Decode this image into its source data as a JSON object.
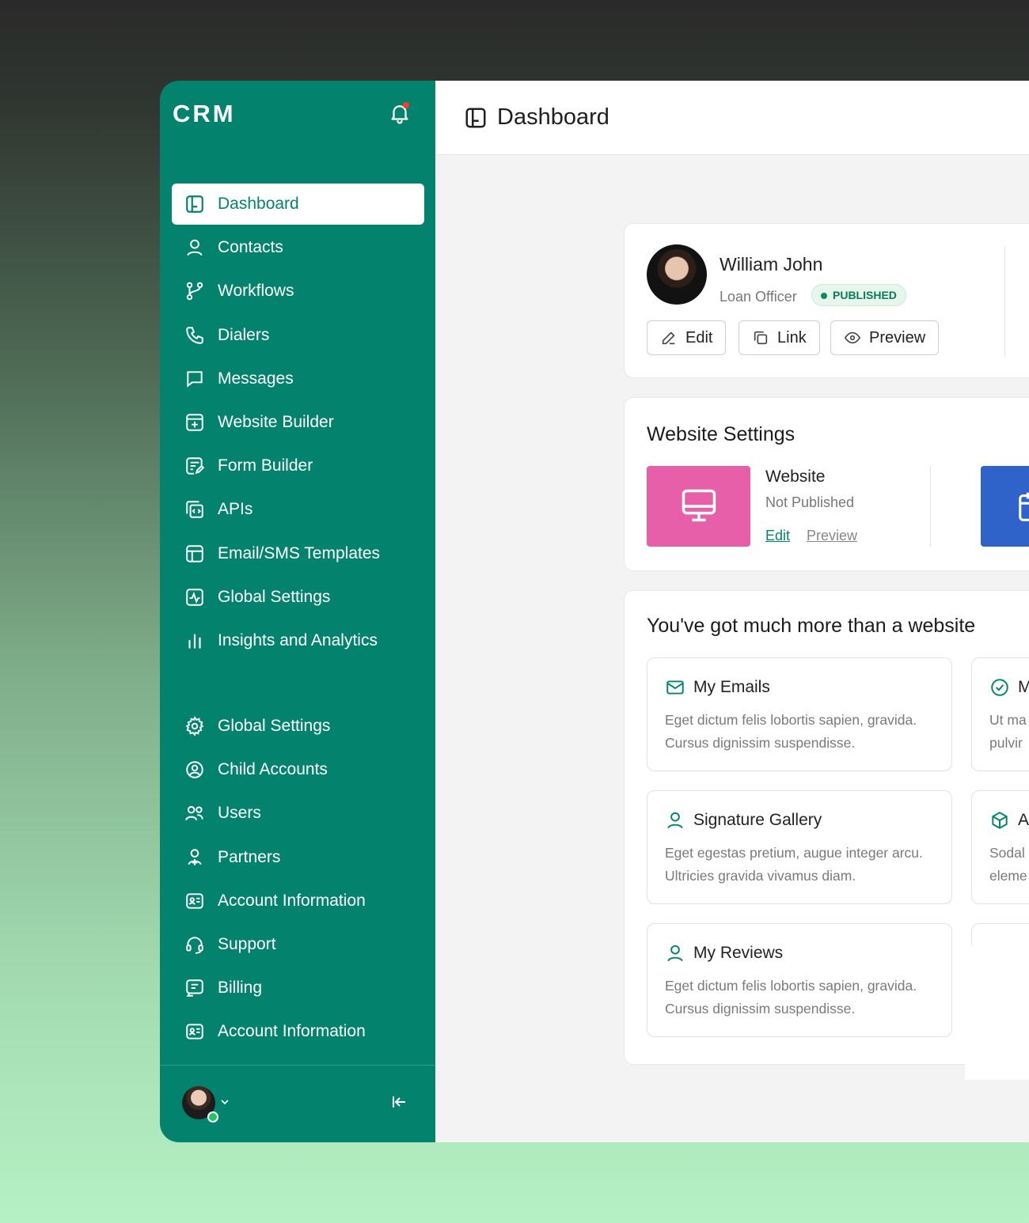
{
  "sidebar": {
    "brand": "CRM",
    "items": [
      {
        "label": "Dashboard",
        "icon": "dashboard-icon",
        "active": true
      },
      {
        "label": "Contacts",
        "icon": "user-icon"
      },
      {
        "label": "Workflows",
        "icon": "git-branch-icon"
      },
      {
        "label": "Dialers",
        "icon": "phone-icon"
      },
      {
        "label": "Messages",
        "icon": "message-icon"
      },
      {
        "label": "Website Builder",
        "icon": "website-builder-icon"
      },
      {
        "label": "Form Builder",
        "icon": "form-builder-icon"
      },
      {
        "label": "APIs",
        "icon": "api-icon"
      },
      {
        "label": "Email/SMS Templates",
        "icon": "template-icon"
      },
      {
        "label": "Global Settings",
        "icon": "activity-icon"
      },
      {
        "label": "Insights and Analytics",
        "icon": "bar-chart-icon"
      }
    ],
    "items2": [
      {
        "label": "Global Settings",
        "icon": "gear-icon"
      },
      {
        "label": "Child Accounts",
        "icon": "user-circle-icon"
      },
      {
        "label": "Users",
        "icon": "users-icon"
      },
      {
        "label": "Partners",
        "icon": "partner-icon"
      },
      {
        "label": "Account Information",
        "icon": "id-card-icon"
      },
      {
        "label": "Support",
        "icon": "headset-icon"
      },
      {
        "label": "Billing",
        "icon": "billing-icon"
      },
      {
        "label": "Account Information",
        "icon": "id-card-icon"
      }
    ]
  },
  "header": {
    "title": "Dashboard"
  },
  "profile": {
    "name": "William John",
    "role": "Loan Officer",
    "status": "PUBLISHED",
    "buttons": {
      "edit": "Edit",
      "link": "Link",
      "preview": "Preview"
    }
  },
  "website_settings": {
    "title": "Website Settings",
    "website_name": "Website",
    "website_status": "Not Published",
    "edit_link": "Edit",
    "preview_link": "Preview"
  },
  "more": {
    "title": "You've got much more than a website",
    "cards": [
      {
        "title": "My Emails",
        "desc": "Eget dictum felis lobortis sapien, gravida. Cursus dignissim suspendisse.",
        "icon": "mail-icon"
      },
      {
        "title": "Signature Gallery",
        "desc": "Eget egestas pretium, augue integer arcu. Ultricies gravida vivamus diam.",
        "icon": "user-icon"
      },
      {
        "title": "My Reviews",
        "desc": "Eget dictum felis lobortis sapien, gravida. Cursus dignissim suspendisse.",
        "icon": "user-icon"
      }
    ],
    "cards_right": [
      {
        "title": "M",
        "line1": "Ut ma",
        "line2": "pulvir",
        "icon": "check-circle-icon"
      },
      {
        "title": "A",
        "line1": "Sodal",
        "line2": "eleme",
        "icon": "box-icon"
      }
    ]
  },
  "colors": {
    "sidebar": "#03836e",
    "accent": "#03836e",
    "pink_tile": "#e85fa9",
    "blue_tile": "#2f63c9",
    "published": "#0c7a5a"
  }
}
